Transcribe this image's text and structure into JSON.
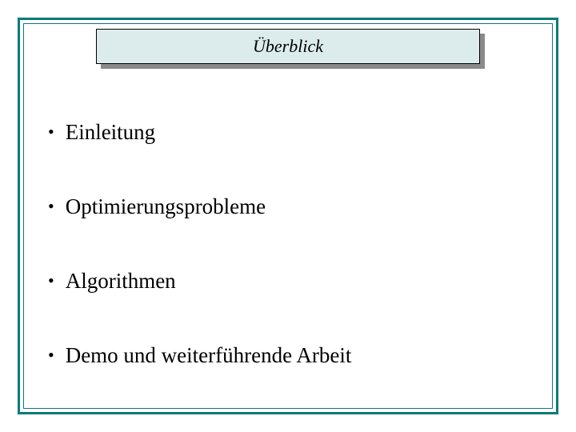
{
  "title": "Überblick",
  "bullets": {
    "b0": "Einleitung",
    "b1": "Optimierungsprobleme",
    "b2": "Algorithmen",
    "b3": "Demo und weiterführende Arbeit"
  }
}
